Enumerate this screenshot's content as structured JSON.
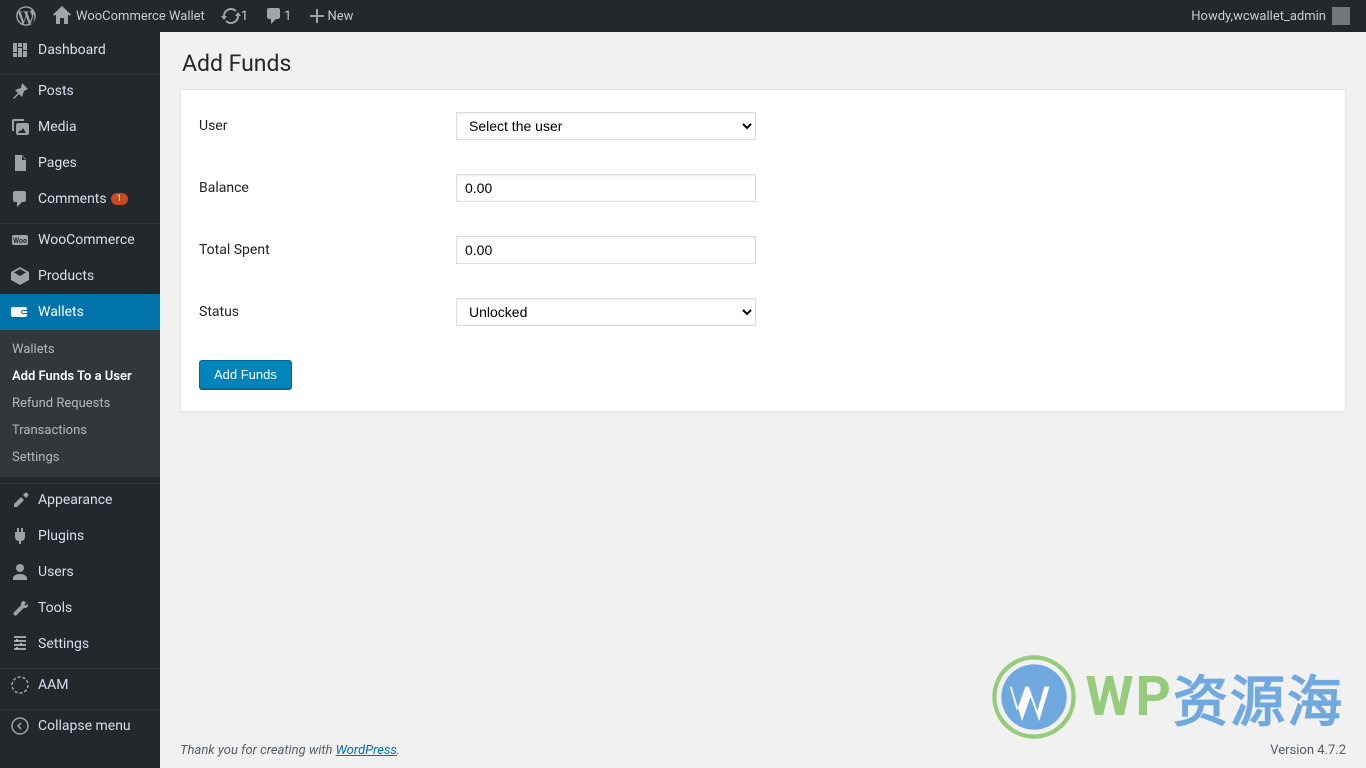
{
  "adminbar": {
    "site_name": "WooCommerce Wallet",
    "update_count": "1",
    "comment_count": "1",
    "new_label": "New",
    "howdy_prefix": "Howdy, ",
    "username": "wcwallet_admin"
  },
  "sidebar": {
    "dashboard": "Dashboard",
    "posts": "Posts",
    "media": "Media",
    "pages": "Pages",
    "comments": "Comments",
    "comments_badge": "1",
    "woocommerce": "WooCommerce",
    "products": "Products",
    "wallets": "Wallets",
    "appearance": "Appearance",
    "plugins": "Plugins",
    "users": "Users",
    "tools": "Tools",
    "settings": "Settings",
    "aam": "AAM",
    "collapse": "Collapse menu",
    "submenu": {
      "wallets": "Wallets",
      "add_funds": "Add Funds To a User",
      "refund": "Refund Requests",
      "transactions": "Transactions",
      "settings": "Settings"
    }
  },
  "page": {
    "title": "Add Funds",
    "labels": {
      "user": "User",
      "balance": "Balance",
      "total_spent": "Total Spent",
      "status": "Status"
    },
    "fields": {
      "user_placeholder": "Select the user",
      "balance_value": "0.00",
      "total_spent_value": "0.00",
      "status_value": "Unlocked"
    },
    "submit_label": "Add Funds"
  },
  "footer": {
    "thanks_prefix": "Thank you for creating with ",
    "wordpress": "WordPress",
    "version": "Version 4.7.2"
  },
  "watermark": {
    "wp": "WP",
    "cn": "资源海"
  }
}
